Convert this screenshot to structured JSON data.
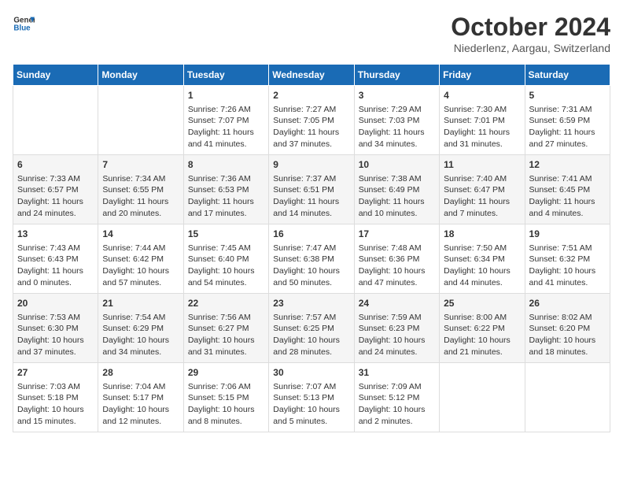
{
  "header": {
    "logo_general": "General",
    "logo_blue": "Blue",
    "month_title": "October 2024",
    "location": "Niederlenz, Aargau, Switzerland"
  },
  "weekdays": [
    "Sunday",
    "Monday",
    "Tuesday",
    "Wednesday",
    "Thursday",
    "Friday",
    "Saturday"
  ],
  "weeks": [
    [
      {
        "day": "",
        "info": ""
      },
      {
        "day": "",
        "info": ""
      },
      {
        "day": "1",
        "info": "Sunrise: 7:26 AM\nSunset: 7:07 PM\nDaylight: 11 hours and 41 minutes."
      },
      {
        "day": "2",
        "info": "Sunrise: 7:27 AM\nSunset: 7:05 PM\nDaylight: 11 hours and 37 minutes."
      },
      {
        "day": "3",
        "info": "Sunrise: 7:29 AM\nSunset: 7:03 PM\nDaylight: 11 hours and 34 minutes."
      },
      {
        "day": "4",
        "info": "Sunrise: 7:30 AM\nSunset: 7:01 PM\nDaylight: 11 hours and 31 minutes."
      },
      {
        "day": "5",
        "info": "Sunrise: 7:31 AM\nSunset: 6:59 PM\nDaylight: 11 hours and 27 minutes."
      }
    ],
    [
      {
        "day": "6",
        "info": "Sunrise: 7:33 AM\nSunset: 6:57 PM\nDaylight: 11 hours and 24 minutes."
      },
      {
        "day": "7",
        "info": "Sunrise: 7:34 AM\nSunset: 6:55 PM\nDaylight: 11 hours and 20 minutes."
      },
      {
        "day": "8",
        "info": "Sunrise: 7:36 AM\nSunset: 6:53 PM\nDaylight: 11 hours and 17 minutes."
      },
      {
        "day": "9",
        "info": "Sunrise: 7:37 AM\nSunset: 6:51 PM\nDaylight: 11 hours and 14 minutes."
      },
      {
        "day": "10",
        "info": "Sunrise: 7:38 AM\nSunset: 6:49 PM\nDaylight: 11 hours and 10 minutes."
      },
      {
        "day": "11",
        "info": "Sunrise: 7:40 AM\nSunset: 6:47 PM\nDaylight: 11 hours and 7 minutes."
      },
      {
        "day": "12",
        "info": "Sunrise: 7:41 AM\nSunset: 6:45 PM\nDaylight: 11 hours and 4 minutes."
      }
    ],
    [
      {
        "day": "13",
        "info": "Sunrise: 7:43 AM\nSunset: 6:43 PM\nDaylight: 11 hours and 0 minutes."
      },
      {
        "day": "14",
        "info": "Sunrise: 7:44 AM\nSunset: 6:42 PM\nDaylight: 10 hours and 57 minutes."
      },
      {
        "day": "15",
        "info": "Sunrise: 7:45 AM\nSunset: 6:40 PM\nDaylight: 10 hours and 54 minutes."
      },
      {
        "day": "16",
        "info": "Sunrise: 7:47 AM\nSunset: 6:38 PM\nDaylight: 10 hours and 50 minutes."
      },
      {
        "day": "17",
        "info": "Sunrise: 7:48 AM\nSunset: 6:36 PM\nDaylight: 10 hours and 47 minutes."
      },
      {
        "day": "18",
        "info": "Sunrise: 7:50 AM\nSunset: 6:34 PM\nDaylight: 10 hours and 44 minutes."
      },
      {
        "day": "19",
        "info": "Sunrise: 7:51 AM\nSunset: 6:32 PM\nDaylight: 10 hours and 41 minutes."
      }
    ],
    [
      {
        "day": "20",
        "info": "Sunrise: 7:53 AM\nSunset: 6:30 PM\nDaylight: 10 hours and 37 minutes."
      },
      {
        "day": "21",
        "info": "Sunrise: 7:54 AM\nSunset: 6:29 PM\nDaylight: 10 hours and 34 minutes."
      },
      {
        "day": "22",
        "info": "Sunrise: 7:56 AM\nSunset: 6:27 PM\nDaylight: 10 hours and 31 minutes."
      },
      {
        "day": "23",
        "info": "Sunrise: 7:57 AM\nSunset: 6:25 PM\nDaylight: 10 hours and 28 minutes."
      },
      {
        "day": "24",
        "info": "Sunrise: 7:59 AM\nSunset: 6:23 PM\nDaylight: 10 hours and 24 minutes."
      },
      {
        "day": "25",
        "info": "Sunrise: 8:00 AM\nSunset: 6:22 PM\nDaylight: 10 hours and 21 minutes."
      },
      {
        "day": "26",
        "info": "Sunrise: 8:02 AM\nSunset: 6:20 PM\nDaylight: 10 hours and 18 minutes."
      }
    ],
    [
      {
        "day": "27",
        "info": "Sunrise: 7:03 AM\nSunset: 5:18 PM\nDaylight: 10 hours and 15 minutes."
      },
      {
        "day": "28",
        "info": "Sunrise: 7:04 AM\nSunset: 5:17 PM\nDaylight: 10 hours and 12 minutes."
      },
      {
        "day": "29",
        "info": "Sunrise: 7:06 AM\nSunset: 5:15 PM\nDaylight: 10 hours and 8 minutes."
      },
      {
        "day": "30",
        "info": "Sunrise: 7:07 AM\nSunset: 5:13 PM\nDaylight: 10 hours and 5 minutes."
      },
      {
        "day": "31",
        "info": "Sunrise: 7:09 AM\nSunset: 5:12 PM\nDaylight: 10 hours and 2 minutes."
      },
      {
        "day": "",
        "info": ""
      },
      {
        "day": "",
        "info": ""
      }
    ]
  ]
}
